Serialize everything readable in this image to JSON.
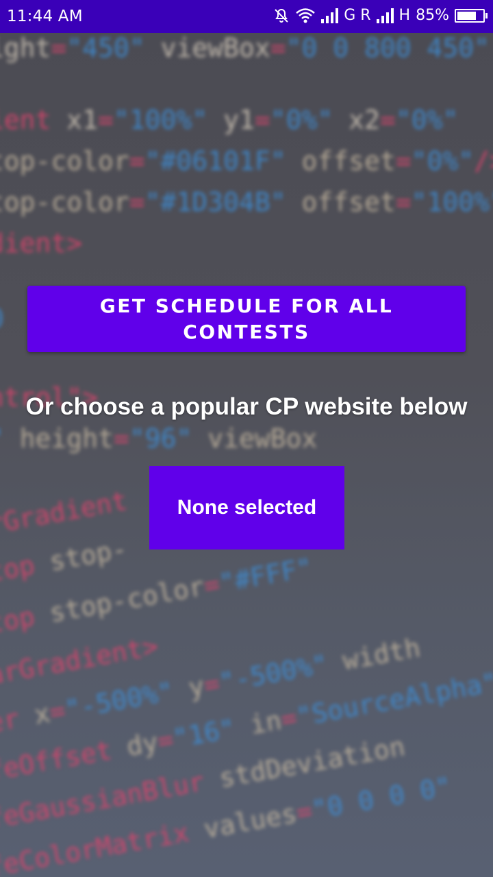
{
  "status_bar": {
    "time": "11:44 AM",
    "network_1": "G R",
    "network_2": "H",
    "battery_percent": "85%",
    "battery_level": 0.85,
    "icons": [
      "bell-off-icon",
      "wifi-icon",
      "signal-icon",
      "signal-icon",
      "battery-icon"
    ]
  },
  "main": {
    "schedule_button": "GET SCHEDULE FOR ALL CONTESTS",
    "subtitle": "Or choose a popular CP website below",
    "website_selector": "None selected"
  },
  "colors": {
    "status_bar": "#3a00b8",
    "accent": "#6000ea"
  }
}
